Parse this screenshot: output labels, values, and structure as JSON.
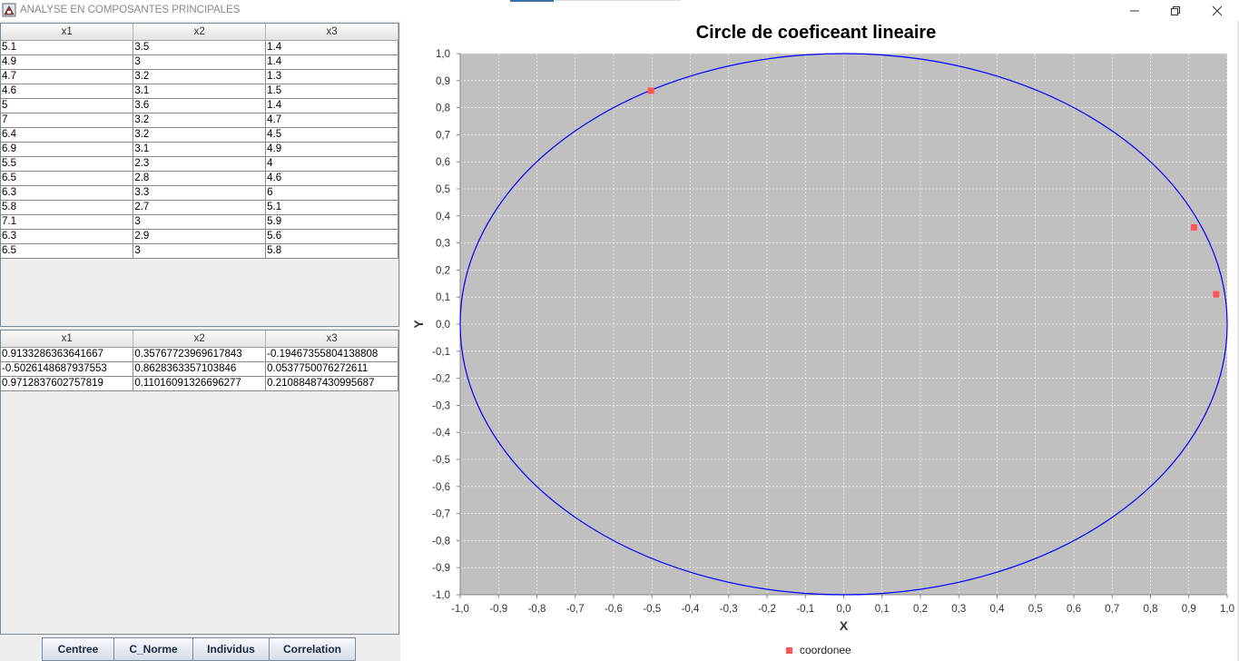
{
  "window": {
    "title": "ANALYSE EN COMPOSANTES PRINCIPALES",
    "controls": {
      "minimize": "—",
      "maximize": "❐",
      "close": "✕"
    }
  },
  "data_table": {
    "columns": [
      "x1",
      "x2",
      "x3"
    ],
    "rows": [
      [
        "5.1",
        "3.5",
        "1.4"
      ],
      [
        "4.9",
        "3",
        "1.4"
      ],
      [
        "4.7",
        "3.2",
        "1.3"
      ],
      [
        "4.6",
        "3.1",
        "1.5"
      ],
      [
        "5",
        "3.6",
        "1.4"
      ],
      [
        "7",
        "3.2",
        "4.7"
      ],
      [
        "6.4",
        "3.2",
        "4.5"
      ],
      [
        "6.9",
        "3.1",
        "4.9"
      ],
      [
        "5.5",
        "2.3",
        "4"
      ],
      [
        "6.5",
        "2.8",
        "4.6"
      ],
      [
        "6.3",
        "3.3",
        "6"
      ],
      [
        "5.8",
        "2.7",
        "5.1"
      ],
      [
        "7.1",
        "3",
        "5.9"
      ],
      [
        "6.3",
        "2.9",
        "5.6"
      ],
      [
        "6.5",
        "3",
        "5.8"
      ]
    ]
  },
  "result_table": {
    "columns": [
      "x1",
      "x2",
      "x3"
    ],
    "rows": [
      [
        "0.9133286363641667",
        "0.35767723969617843",
        "-0.19467355804138808"
      ],
      [
        "-0.5026148687937553",
        "0.8628363357103846",
        "0.0537750076272611"
      ],
      [
        "0.9712837602757819",
        "0.11016091326696277",
        "0.21088487430995687"
      ]
    ]
  },
  "buttons": [
    "Centree",
    "C_Norme",
    "Individus",
    "Correlation"
  ],
  "colors": {
    "plot_background": "#c0c0c0",
    "circle": "#0000ff",
    "points": "#ff5555",
    "panel": "#eeeeee"
  },
  "chart_data": {
    "type": "scatter",
    "title": "Circle de coeficeant lineaire",
    "xlabel": "X",
    "ylabel": "Y",
    "xlim": [
      -1.0,
      1.0
    ],
    "ylim": [
      -1.0,
      1.0
    ],
    "grid": true,
    "legend_position": "bottom",
    "x_ticks": [
      "-1,0",
      "-0,9",
      "-0,8",
      "-0,7",
      "-0,6",
      "-0,5",
      "-0,4",
      "-0,3",
      "-0,2",
      "-0,1",
      "0,0",
      "0,1",
      "0,2",
      "0,3",
      "0,4",
      "0,5",
      "0,6",
      "0,7",
      "0,8",
      "0,9",
      "1,0"
    ],
    "y_ticks": [
      "1,0",
      "0,9",
      "0,8",
      "0,7",
      "0,6",
      "0,5",
      "0,4",
      "0,3",
      "0,2",
      "0,1",
      "0,0",
      "-0,1",
      "-0,2",
      "-0,3",
      "-0,4",
      "-0,5",
      "-0,6",
      "-0,7",
      "-0,8",
      "-0,9",
      "-1,0"
    ],
    "unit_circle": {
      "center": [
        0,
        0
      ],
      "radius": 1
    },
    "series": [
      {
        "name": "coordonee",
        "points": [
          {
            "x": -0.5026,
            "y": 0.8628
          },
          {
            "x": 0.9133,
            "y": 0.3577
          },
          {
            "x": 0.9713,
            "y": 0.1102
          }
        ]
      }
    ]
  }
}
